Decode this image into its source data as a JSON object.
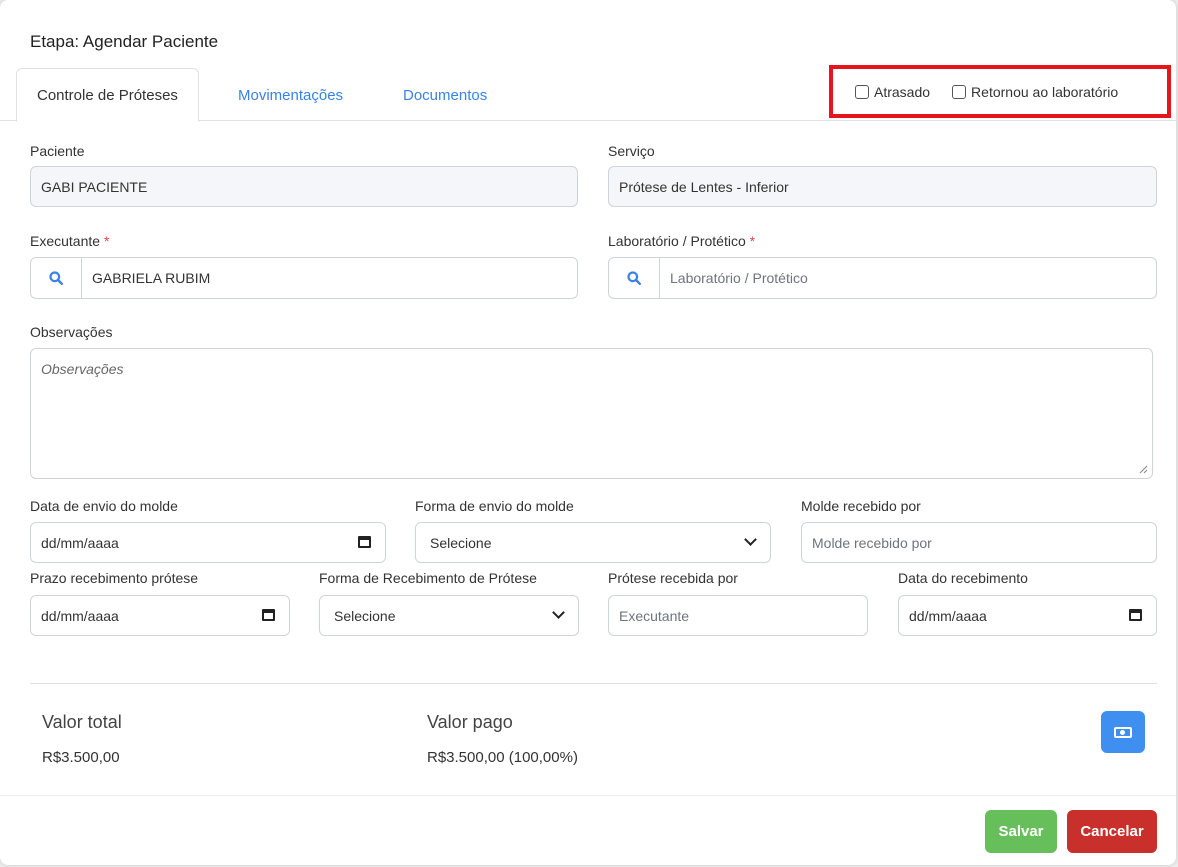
{
  "modal": {
    "title": "Etapa: Agendar Paciente"
  },
  "tabs": [
    {
      "label": "Controle de Próteses",
      "active": true
    },
    {
      "label": "Movimentações",
      "active": false
    },
    {
      "label": "Documentos",
      "active": false
    }
  ],
  "flags": {
    "atrasado": {
      "label": "Atrasado",
      "checked": false
    },
    "retornou": {
      "label": "Retornou ao laboratório",
      "checked": false
    }
  },
  "form": {
    "paciente": {
      "label": "Paciente",
      "value": "GABI PACIENTE"
    },
    "servico": {
      "label": "Serviço",
      "value": "Prótese de Lentes - Inferior"
    },
    "executante": {
      "label": "Executante",
      "required_mark": "*",
      "value": "GABRIELA RUBIM"
    },
    "laboratorio": {
      "label": "Laboratório / Protético",
      "required_mark": "*",
      "placeholder": "Laboratório / Protético"
    },
    "observacoes": {
      "label": "Observações",
      "placeholder": "Observações"
    },
    "data_envio": {
      "label": "Data de envio do molde",
      "value": "dd/mm/aaaa"
    },
    "forma_envio": {
      "label": "Forma de envio do molde",
      "value": "Selecione"
    },
    "molde_recebido": {
      "label": "Molde recebido por",
      "placeholder": "Molde recebido por"
    },
    "prazo_recebimento": {
      "label": "Prazo recebimento prótese",
      "value": "dd/mm/aaaa"
    },
    "forma_recebimento": {
      "label": "Forma de Recebimento de Prótese",
      "value": "Selecione"
    },
    "protese_recebida": {
      "label": "Prótese recebida por",
      "placeholder": "Executante"
    },
    "data_recebimento": {
      "label": "Data do recebimento",
      "value": "dd/mm/aaaa"
    }
  },
  "summary": {
    "total_label": "Valor total",
    "total_value": "R$3.500,00",
    "pago_label": "Valor pago",
    "pago_value": "R$3.500,00 (100,00%)"
  },
  "footer": {
    "save_label": "Salvar",
    "cancel_label": "Cancelar"
  },
  "colors": {
    "accent": "#3a82e6",
    "highlight_box": "#e8141b",
    "save": "#66bf5a",
    "cancel": "#c9302c",
    "payment_button": "#3f8ff0"
  }
}
